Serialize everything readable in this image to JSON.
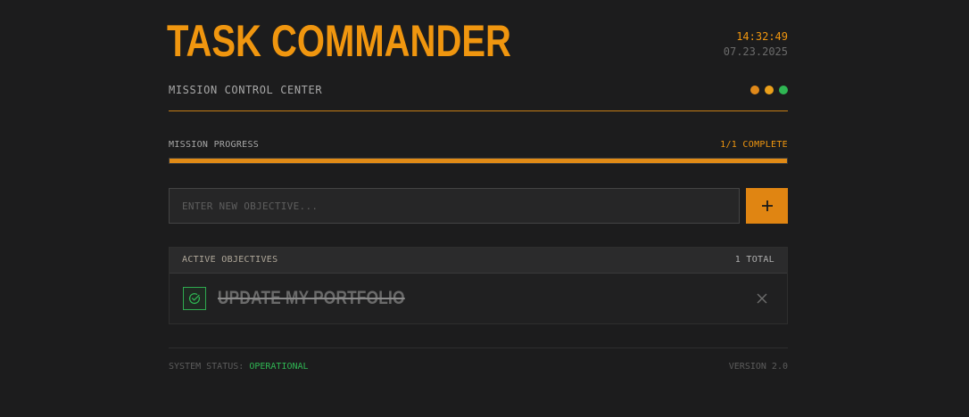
{
  "header": {
    "title": "TASK COMMANDER",
    "time": "14:32:49",
    "date": "07.23.2025",
    "subtitle": "MISSION CONTROL CENTER",
    "status_dots": [
      {
        "name": "orange-dot",
        "color": "#e0891a"
      },
      {
        "name": "amber-dot",
        "color": "#eba01b"
      },
      {
        "name": "green-dot",
        "color": "#2fb653"
      }
    ]
  },
  "progress": {
    "label": "MISSION PROGRESS",
    "count_text": "1/1 COMPLETE",
    "fraction": 1.0
  },
  "new_objective": {
    "placeholder": "ENTER NEW OBJECTIVE...",
    "value": "",
    "add_icon": "plus-icon"
  },
  "objectives": {
    "title": "ACTIVE OBJECTIVES",
    "count_text": "1 TOTAL",
    "items": [
      {
        "text": "UPDATE MY PORTFOLIO",
        "completed": true,
        "check_icon": "check-circle-icon",
        "delete_icon": "close-icon"
      }
    ]
  },
  "footer": {
    "status_label": "SYSTEM STATUS:",
    "status_value": "OPERATIONAL",
    "version": "VERSION 2.0"
  },
  "colors": {
    "accent": "#f0960f",
    "button": "#e08512",
    "success": "#2fb653",
    "background": "#1c1c1d"
  }
}
